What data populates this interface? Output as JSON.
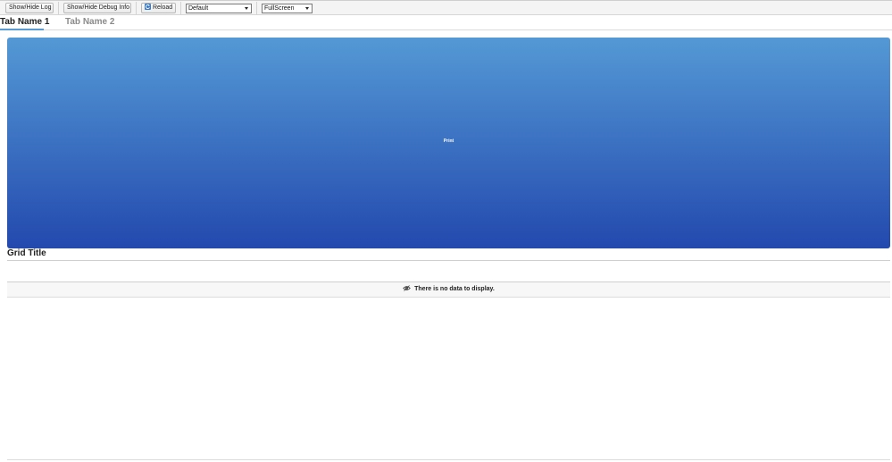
{
  "toolbar": {
    "show_hide_log": "Show/Hide Log",
    "show_hide_debug": "Show/Hide Debug Info",
    "reload": "Reload",
    "theme_select": {
      "value": "Default"
    },
    "view_select": {
      "value": "FullScreen"
    }
  },
  "tabs": [
    {
      "label": "Tab Name 1",
      "active": true
    },
    {
      "label": "Tab Name 2",
      "active": false
    }
  ],
  "banner": {
    "label": "Print",
    "gradient_top": "#5499d5",
    "gradient_bottom": "#2349ae"
  },
  "grid": {
    "title": "Grid Title",
    "empty_message": "There is no data to display.",
    "empty_icon": "eye-off-icon"
  },
  "colors": {
    "tab_underline": "#5b9bd5"
  }
}
